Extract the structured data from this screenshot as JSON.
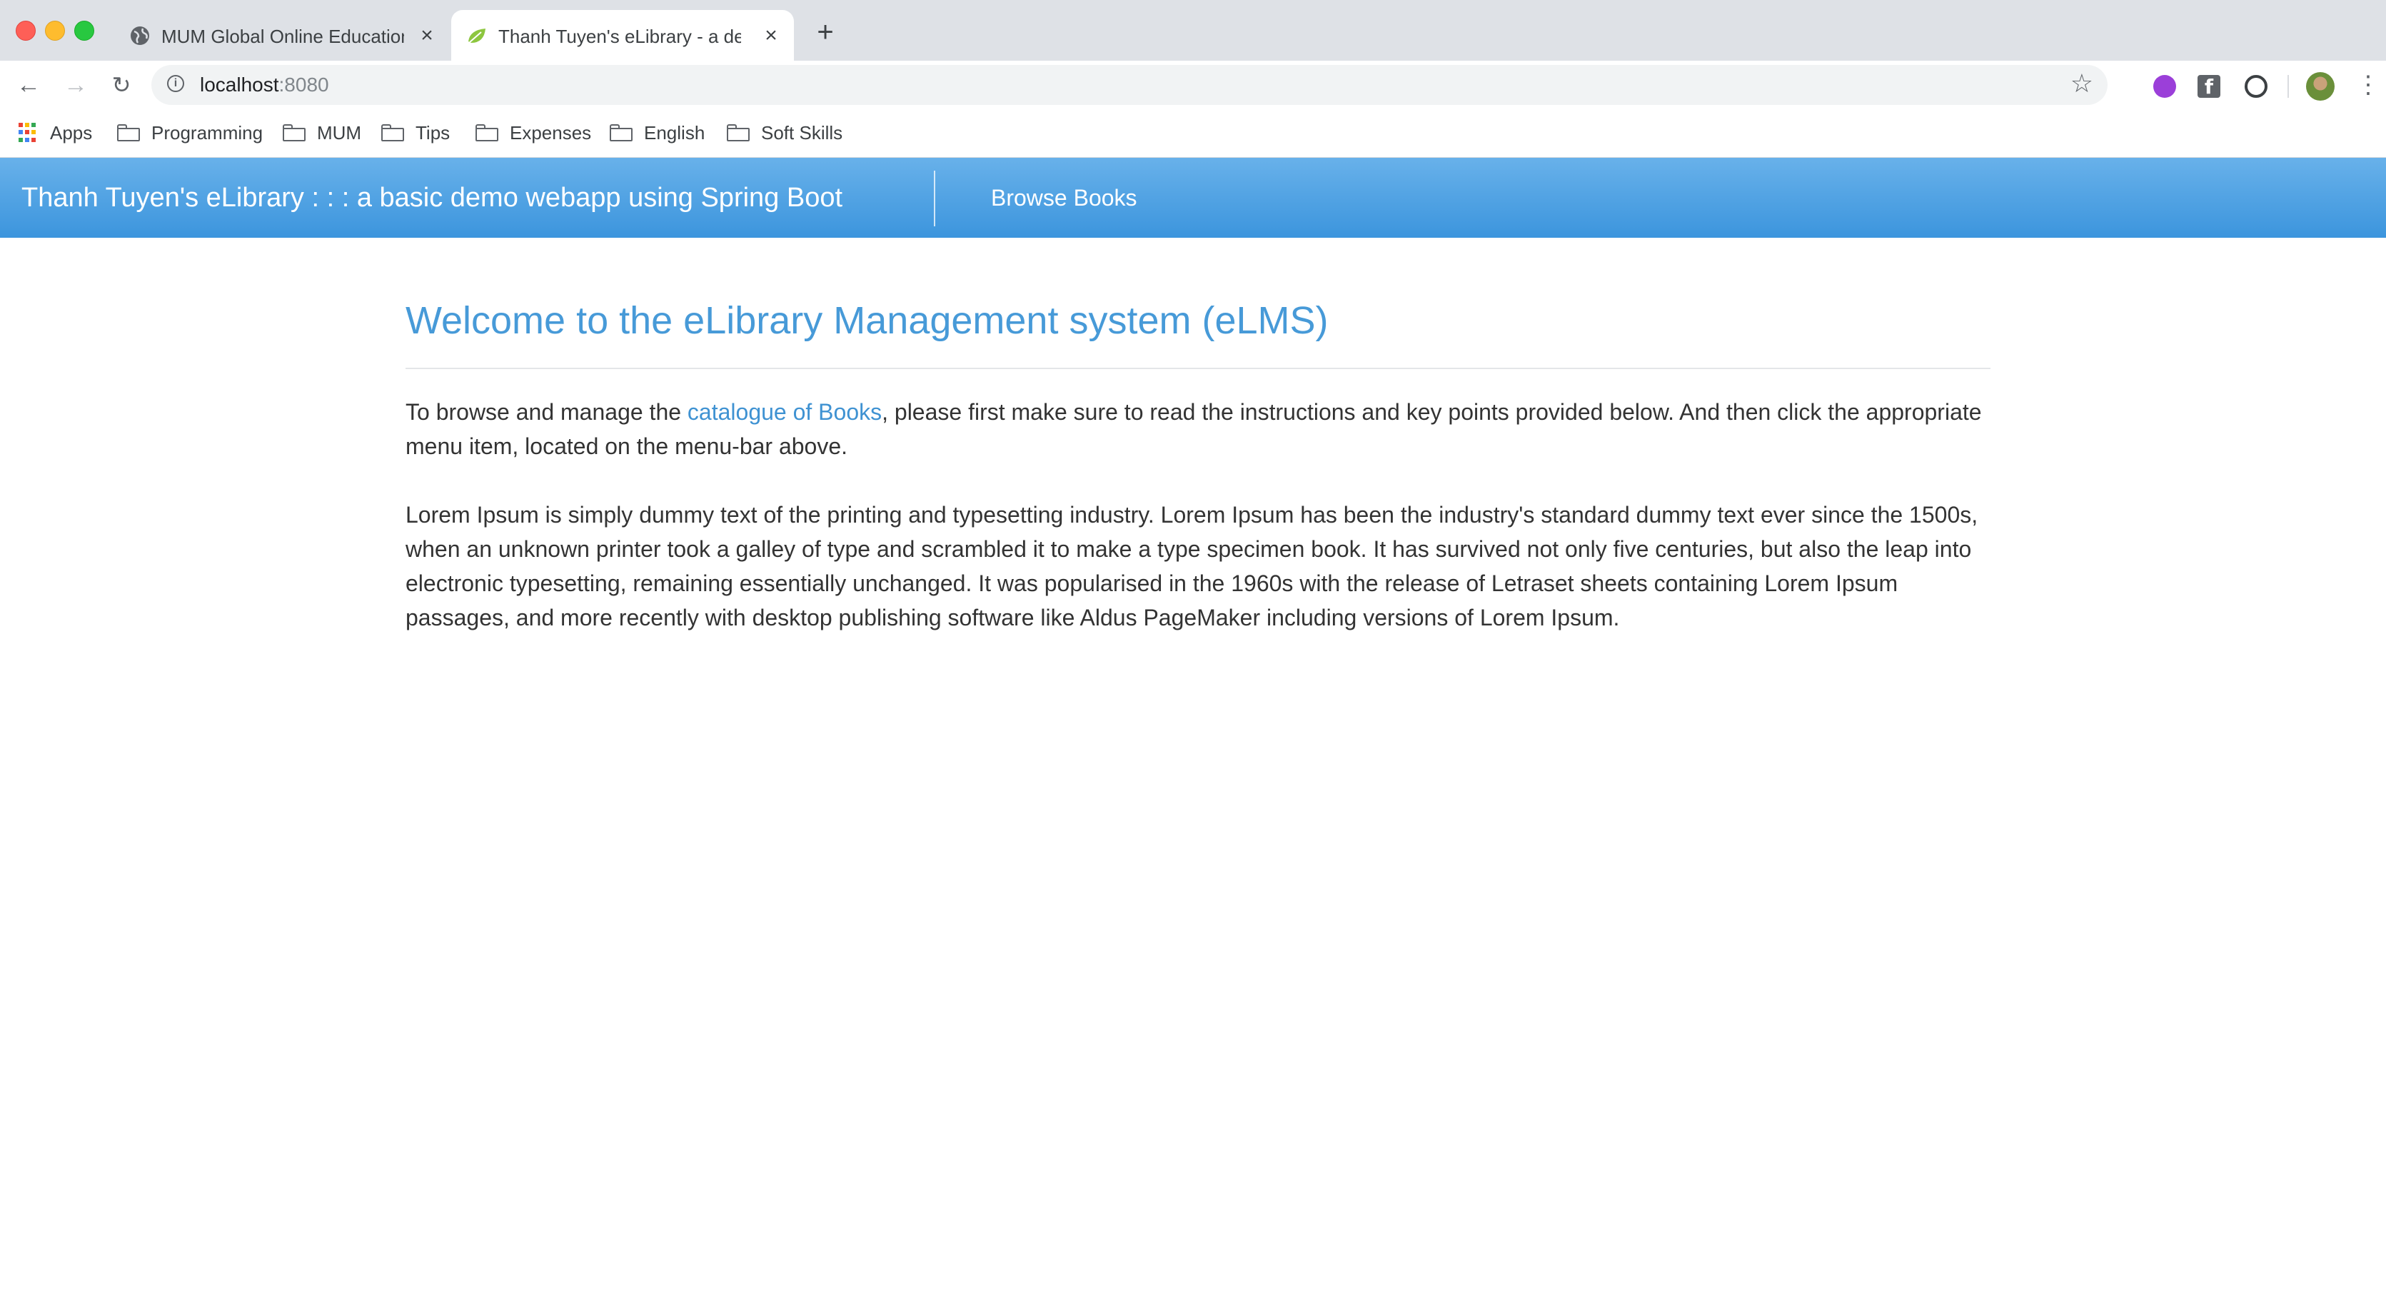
{
  "browser": {
    "tabs": [
      {
        "title": "MUM Global Online Education",
        "active": false,
        "icon": "globe-icon"
      },
      {
        "title": "Thanh Tuyen's eLibrary - a demo",
        "active": true,
        "icon": "spring-leaf-icon"
      }
    ],
    "new_tab_symbol": "+",
    "close_symbol": "×",
    "url_host": "localhost",
    "url_port": ":8080",
    "bookmarks": [
      {
        "label": "Apps",
        "icon": "apps-grid-icon"
      },
      {
        "label": "Programming",
        "icon": "folder-icon"
      },
      {
        "label": "MUM",
        "icon": "folder-icon"
      },
      {
        "label": "Tips",
        "icon": "folder-icon"
      },
      {
        "label": "Expenses",
        "icon": "folder-icon"
      },
      {
        "label": "English",
        "icon": "folder-icon"
      },
      {
        "label": "Soft Skills",
        "icon": "folder-icon"
      }
    ],
    "extensions_fb_letter": "f"
  },
  "navbar": {
    "brand": "Thanh Tuyen's eLibrary : : : a basic demo webapp using Spring Boot",
    "links": [
      {
        "label": "Browse Books"
      }
    ],
    "gradient": [
      "#68b1ea",
      "#3c95dd"
    ]
  },
  "main": {
    "heading": "Welcome to the eLibrary Management system (eLMS)",
    "intro_before": "To browse and manage the ",
    "intro_link": "catalogue of Books",
    "intro_after": ", please first make sure to read the instructions and key points provided below. And then click the appropriate menu item, located on the menu-bar above.",
    "lorem": "Lorem Ipsum is simply dummy text of the printing and typesetting industry. Lorem Ipsum has been the industry's standard dummy text ever since the 1500s, when an unknown printer took a galley of type and scrambled it to make a type specimen book. It has survived not only five centuries, but also the leap into electronic typesetting, remaining essentially unchanged. It was popularised in the 1960s with the release of Letraset sheets containing Lorem Ipsum passages, and more recently with desktop publishing software like Aldus PageMaker including versions of Lorem Ipsum."
  },
  "colors": {
    "heading": "#479ad8",
    "link": "#3f92d2",
    "text": "#333333"
  }
}
